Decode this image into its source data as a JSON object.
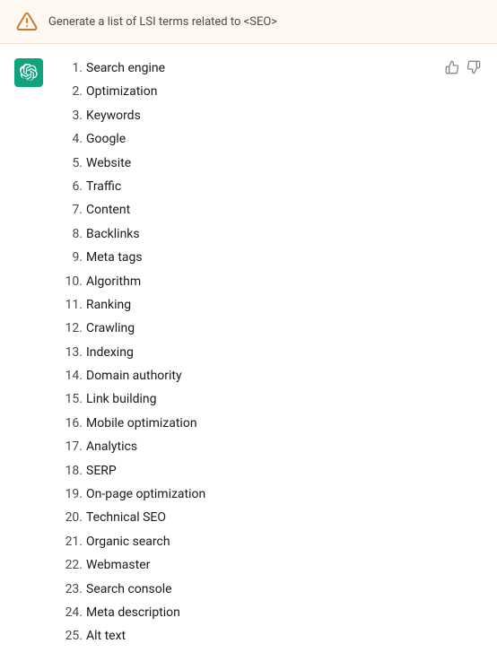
{
  "header": {
    "icon_alt": "warning-triangle",
    "prompt": "Generate a list of LSI terms related to <SEO>"
  },
  "message": {
    "items": [
      {
        "number": "1.",
        "text": "Search engine"
      },
      {
        "number": "2.",
        "text": "Optimization"
      },
      {
        "number": "3.",
        "text": "Keywords"
      },
      {
        "number": "4.",
        "text": "Google"
      },
      {
        "number": "5.",
        "text": "Website"
      },
      {
        "number": "6.",
        "text": "Traffic"
      },
      {
        "number": "7.",
        "text": "Content"
      },
      {
        "number": "8.",
        "text": "Backlinks"
      },
      {
        "number": "9.",
        "text": "Meta tags"
      },
      {
        "number": "10.",
        "text": "Algorithm"
      },
      {
        "number": "11.",
        "text": "Ranking"
      },
      {
        "number": "12.",
        "text": "Crawling"
      },
      {
        "number": "13.",
        "text": "Indexing"
      },
      {
        "number": "14.",
        "text": "Domain authority"
      },
      {
        "number": "15.",
        "text": "Link building"
      },
      {
        "number": "16.",
        "text": "Mobile optimization"
      },
      {
        "number": "17.",
        "text": "Analytics"
      },
      {
        "number": "18.",
        "text": "SERP"
      },
      {
        "number": "19.",
        "text": "On-page optimization"
      },
      {
        "number": "20.",
        "text": "Technical SEO"
      },
      {
        "number": "21.",
        "text": "Organic search"
      },
      {
        "number": "22.",
        "text": "Webmaster"
      },
      {
        "number": "23.",
        "text": "Search console"
      },
      {
        "number": "24.",
        "text": "Meta description"
      },
      {
        "number": "25.",
        "text": "Alt text"
      }
    ],
    "thumbup_label": "thumbs up",
    "thumbdown_label": "thumbs down"
  }
}
